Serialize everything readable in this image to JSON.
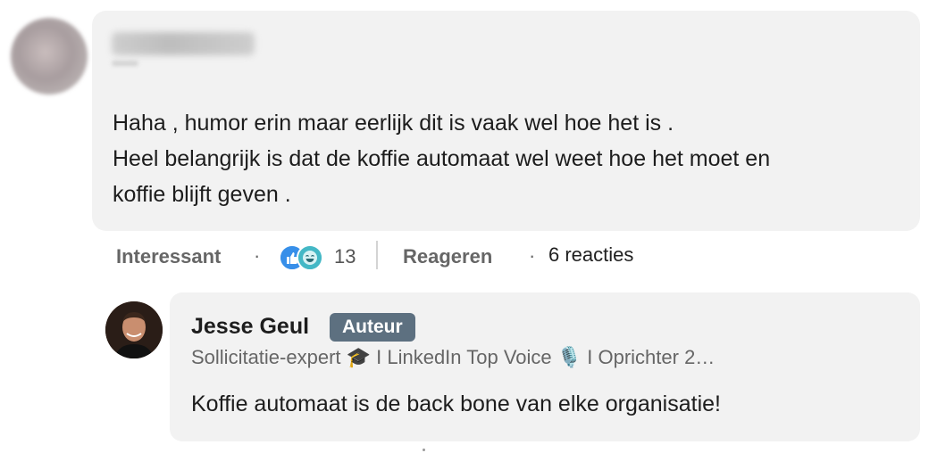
{
  "comment": {
    "text": "Haha , humor erin maar eerlijk dit is vaak wel hoe het is .\nHeel belangrijk is dat de koffie automaat wel weet hoe het moet en\nkoffie blijft geven ."
  },
  "actions": {
    "reaction_label": "Interessant",
    "separator": "·",
    "reaction_count": "13",
    "reply_label": "Reageren",
    "replies_count_text": "6 reacties",
    "colors": {
      "like": "#378fe9",
      "funny": "#44b8c6"
    }
  },
  "reply": {
    "author_name": "Jesse Geul",
    "author_badge": "Auteur",
    "headline": "Sollicitatie-expert 🎓 I LinkedIn Top Voice 🎙️ I Oprichter 2…",
    "text": "Koffie automaat is de back bone van elke organisatie!",
    "badge_color": "#5d7080"
  }
}
